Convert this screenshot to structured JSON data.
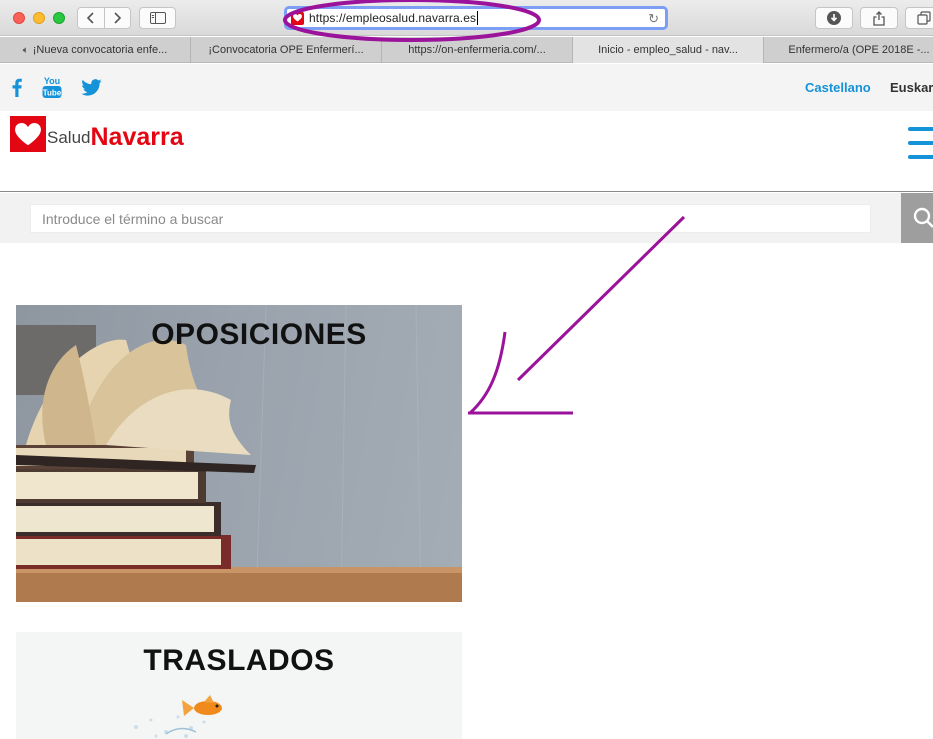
{
  "browser": {
    "url": "https://empleosalud.navarra.es",
    "tabs": [
      {
        "label": "¡Nueva convocatoria enfe...",
        "active": false,
        "muted_icon": true
      },
      {
        "label": "¡Convocatoria OPE Enfermerí...",
        "active": false
      },
      {
        "label": "https://on-enfermeria.com/...",
        "active": false
      },
      {
        "label": "Inicio - empleo_salud - nav...",
        "active": true
      },
      {
        "label": "Enfermero/a (OPE 2018E -...",
        "active": false
      }
    ]
  },
  "social": {
    "icons": [
      "facebook-icon",
      "youtube-icon",
      "twitter-icon"
    ],
    "youtube_text": "You Tube"
  },
  "languages": {
    "castellano": "Castellano",
    "euskara": "Euskar"
  },
  "logo": {
    "salud": "Salud",
    "navarra": "Navarra"
  },
  "search": {
    "placeholder": "Introduce el término a buscar"
  },
  "cards": [
    {
      "title": "OPOSICIONES"
    },
    {
      "title": "TRASLADOS"
    }
  ],
  "colors": {
    "brand_red": "#e30613",
    "link_blue": "#1493d8",
    "annotation_purple": "#9b139b"
  }
}
